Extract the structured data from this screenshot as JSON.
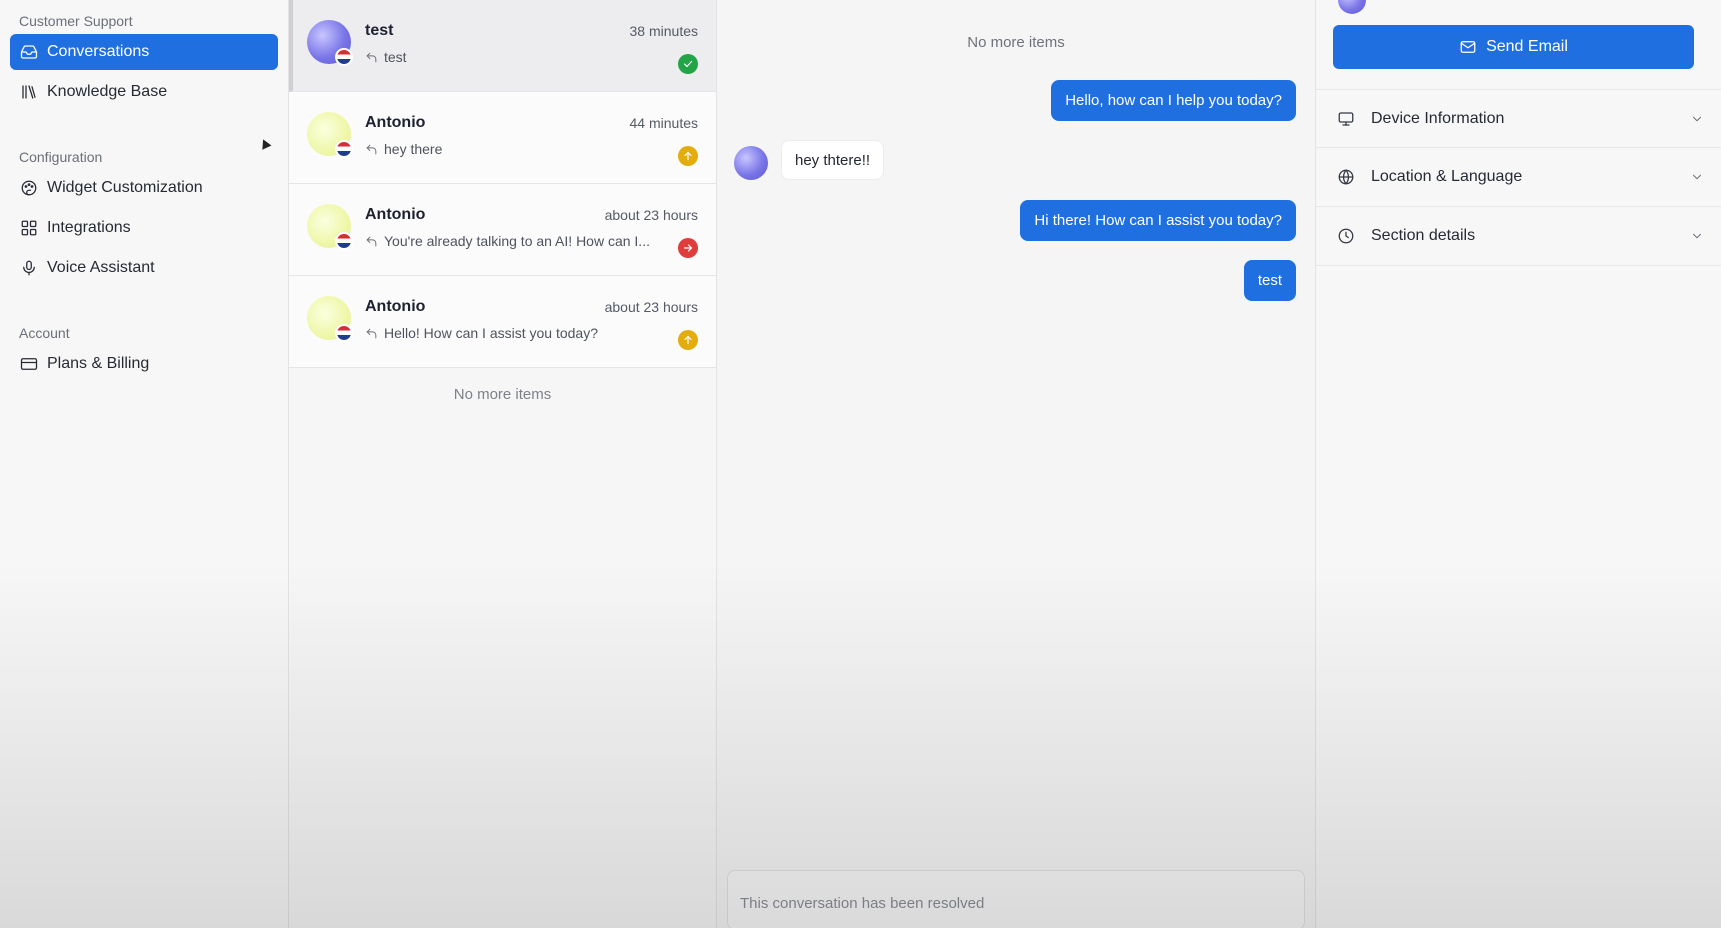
{
  "sidebar": {
    "section_support": "Customer Support",
    "section_config": "Configuration",
    "section_account": "Account",
    "items": [
      {
        "label": "Conversations",
        "icon": "inbox-icon"
      },
      {
        "label": "Knowledge Base",
        "icon": "library-icon"
      },
      {
        "label": "Widget Customization",
        "icon": "palette-icon"
      },
      {
        "label": "Integrations",
        "icon": "grid-icon"
      },
      {
        "label": "Voice Assistant",
        "icon": "microphone-icon"
      },
      {
        "label": "Plans & Billing",
        "icon": "credit-card-icon"
      }
    ]
  },
  "conversations": {
    "items": [
      {
        "name": "test",
        "time": "38 minutes",
        "preview": "test",
        "status": "resolved"
      },
      {
        "name": "Antonio",
        "time": "44 minutes",
        "preview": "hey there",
        "status": "escalated"
      },
      {
        "name": "Antonio",
        "time": "about 23 hours",
        "preview": "You're already talking to an AI! How can I...",
        "status": "transferred"
      },
      {
        "name": "Antonio",
        "time": "about 23 hours",
        "preview": "Hello! How can I assist you today?",
        "status": "escalated"
      }
    ],
    "end_text": "No more items"
  },
  "chat": {
    "top_text": "No more items",
    "messages": [
      {
        "from": "agent",
        "text": "Hello, how can I help you today?"
      },
      {
        "from": "user",
        "text": "hey thtere!!"
      },
      {
        "from": "agent",
        "text": "Hi there! How can I assist you today?"
      },
      {
        "from": "agent",
        "text": "test"
      }
    ],
    "resolved_text": "This conversation has been resolved"
  },
  "details": {
    "send_email_label": "Send Email",
    "sections": [
      {
        "label": "Device Information",
        "icon": "monitor-icon"
      },
      {
        "label": "Location & Language",
        "icon": "globe-icon"
      },
      {
        "label": "Section details",
        "icon": "clock-icon"
      }
    ]
  },
  "colors": {
    "accent": "#1f6fe0",
    "status_green": "#22a447",
    "status_yellow": "#e4ad0f",
    "status_red": "#e03c3c"
  }
}
